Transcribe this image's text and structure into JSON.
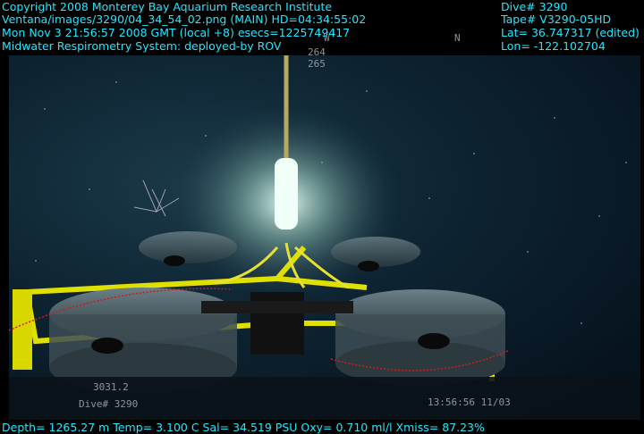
{
  "overlay": {
    "top_left": [
      "Copyright 2008 Monterey Bay Aquarium Research Institute",
      "Ventana/images/3290/04_34_54_02.png (MAIN)  HD=04:34:55:02",
      "Mon Nov  3 21:56:57 2008 GMT (local +8)  esecs=1225749417",
      "Midwater Respirometry System: deployed-by ROV"
    ],
    "top_right": [
      "Dive# 3290",
      "Tape# V3290-05HD",
      "Lat= 36.747317 (edited)",
      "Lon= -122.102704"
    ],
    "bottom": "Depth= 1265.27 m  Temp= 3.100 C  Sal= 34.519 PSU  Oxy= 0.710 ml/l  Xmiss= 87.23%"
  },
  "camera_hud": {
    "compass_w": "W",
    "compass_n": "N",
    "heading_1": "264",
    "heading_2": "265",
    "altitude": "3031.2",
    "dive": "Dive# 3290",
    "timecode": "13:56:56 11/03"
  },
  "colors": {
    "overlay_text": "#22e6ff",
    "water": "#0e2432",
    "frame_yellow": "#e0e000",
    "laser_red": "#d01818"
  }
}
